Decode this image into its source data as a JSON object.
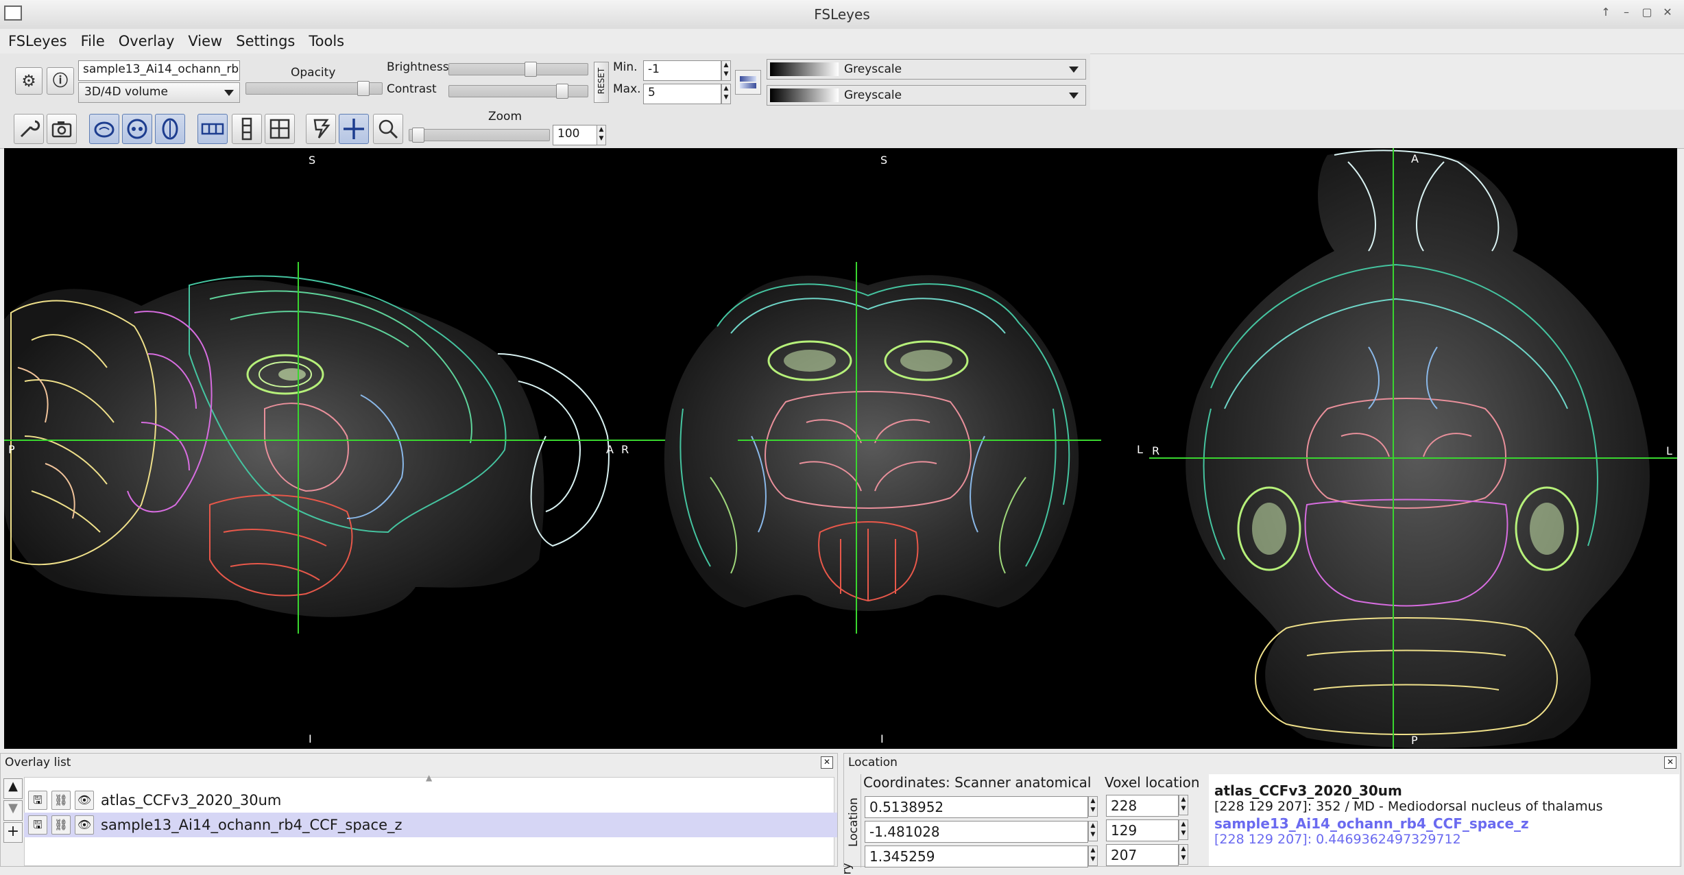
{
  "window": {
    "title": "FSLeyes"
  },
  "menu": [
    "FSLeyes",
    "File",
    "Overlay",
    "View",
    "Settings",
    "Tools"
  ],
  "overlay_toolbar": {
    "overlay_name": "sample13_Ai14_ochann_rb4_",
    "overlay_type": "3D/4D volume",
    "opacity_label": "Opacity",
    "brightness_label": "Brightness",
    "contrast_label": "Contrast",
    "reset_label": "RESET",
    "min_label": "Min.",
    "max_label": "Max.",
    "min_value": "-1",
    "max_value": "5",
    "colormap_1": "Greyscale",
    "colormap_2": "Greyscale",
    "opacity_level": 0.9,
    "brightness_level": 0.6,
    "contrast_level": 0.85
  },
  "ortho_toolbar": {
    "zoom_label": "Zoom",
    "zoom_value": "100"
  },
  "canvas": {
    "sagittal": {
      "top": "S",
      "bottom": "I",
      "left": "P",
      "right": "A"
    },
    "coronal": {
      "top": "S",
      "bottom": "I",
      "left": "R",
      "right": "L"
    },
    "axial": {
      "top": "A",
      "bottom": "P",
      "left": "R",
      "right": "L"
    }
  },
  "overlay_list": {
    "title": "Overlay list",
    "items": [
      "atlas_CCFv3_2020_30um",
      "sample13_Ai14_ochann_rb4_CCF_space_z"
    ]
  },
  "location": {
    "title": "Location",
    "side_tab": "Location",
    "side_tab_2": "ry",
    "coords_header": "Coordinates: Scanner anatomical",
    "voxel_header": "Voxel location",
    "coords": [
      "0.5138952",
      "-1.481028",
      "1.345259"
    ],
    "voxels": [
      "228",
      "129",
      "207"
    ],
    "info_title": "atlas_CCFv3_2020_30um",
    "info_line1": "[228 129 207]: 352 / MD - Mediodorsal nucleus of thalamus",
    "info_title2": "sample13_Ai14_ochann_rb4_CCF_space_z",
    "info_line2": "[228 129 207]: 0.4469362497329712"
  },
  "colors": {
    "crosshair": "#39d62f",
    "selected_row": "#d6d6f5",
    "info_link": "#6a6af0"
  }
}
